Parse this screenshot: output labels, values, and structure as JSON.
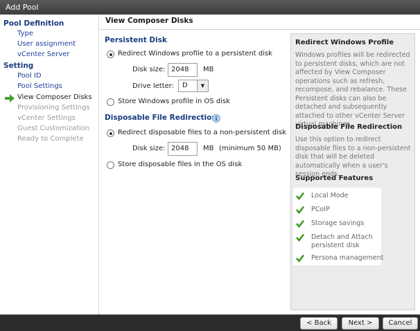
{
  "window": {
    "title": "Add Pool"
  },
  "sidebar": {
    "section1": "Pool Definition",
    "items1": [
      "Type",
      "User assignment",
      "vCenter Server"
    ],
    "section2": "Setting",
    "items2": [
      "Pool ID",
      "Pool Settings",
      "View Composer Disks",
      "Provisioning Settings",
      "vCenter Settings",
      "Guest Customization",
      "Ready to Complete"
    ]
  },
  "main": {
    "title": "View Composer Disks",
    "persistent": {
      "heading": "Persistent Disk",
      "redirect_label": "Redirect Windows profile to a persistent disk",
      "disk_size_label": "Disk size:",
      "disk_size_value": "2048",
      "disk_size_unit": "MB",
      "drive_letter_label": "Drive letter:",
      "drive_letter_value": "D",
      "store_label": "Store Windows profile in OS disk"
    },
    "disposable": {
      "heading": "Disposable File Redirection",
      "redirect_label": "Redirect disposable files to a non-persistent disk",
      "disk_size_label": "Disk size:",
      "disk_size_value": "2048",
      "disk_size_unit": "MB",
      "minimum_note": "(minimum 50 MB)",
      "store_label": "Store disposable files in the OS disk"
    },
    "help": {
      "h1": "Redirect Windows Profile",
      "p1": "Windows profiles will be redirected to persistent disks, which are not affected by View Composer operations such as refresh, recompose, and rebalance. These Persistent disks can also be detached and subsequently attached to other vCenter Server virtual machines.",
      "h2": "Disposable File Redirection",
      "p2": "Use this option to redirect disposable files to a non-persistent disk that will be deleted automatically when a user's session ends.",
      "h3": "Supported Features",
      "features": [
        "Local Mode",
        "PCoIP",
        "Storage savings",
        "Detach and Attach persistent disk",
        "Persona management"
      ]
    }
  },
  "footer": {
    "back": "< Back",
    "next": "Next >",
    "cancel": "Cancel"
  },
  "colors": {
    "accent": "#1a3c80",
    "link": "#1f3f9e",
    "check": "#3a9a1e",
    "arrow": "#43a12a"
  }
}
